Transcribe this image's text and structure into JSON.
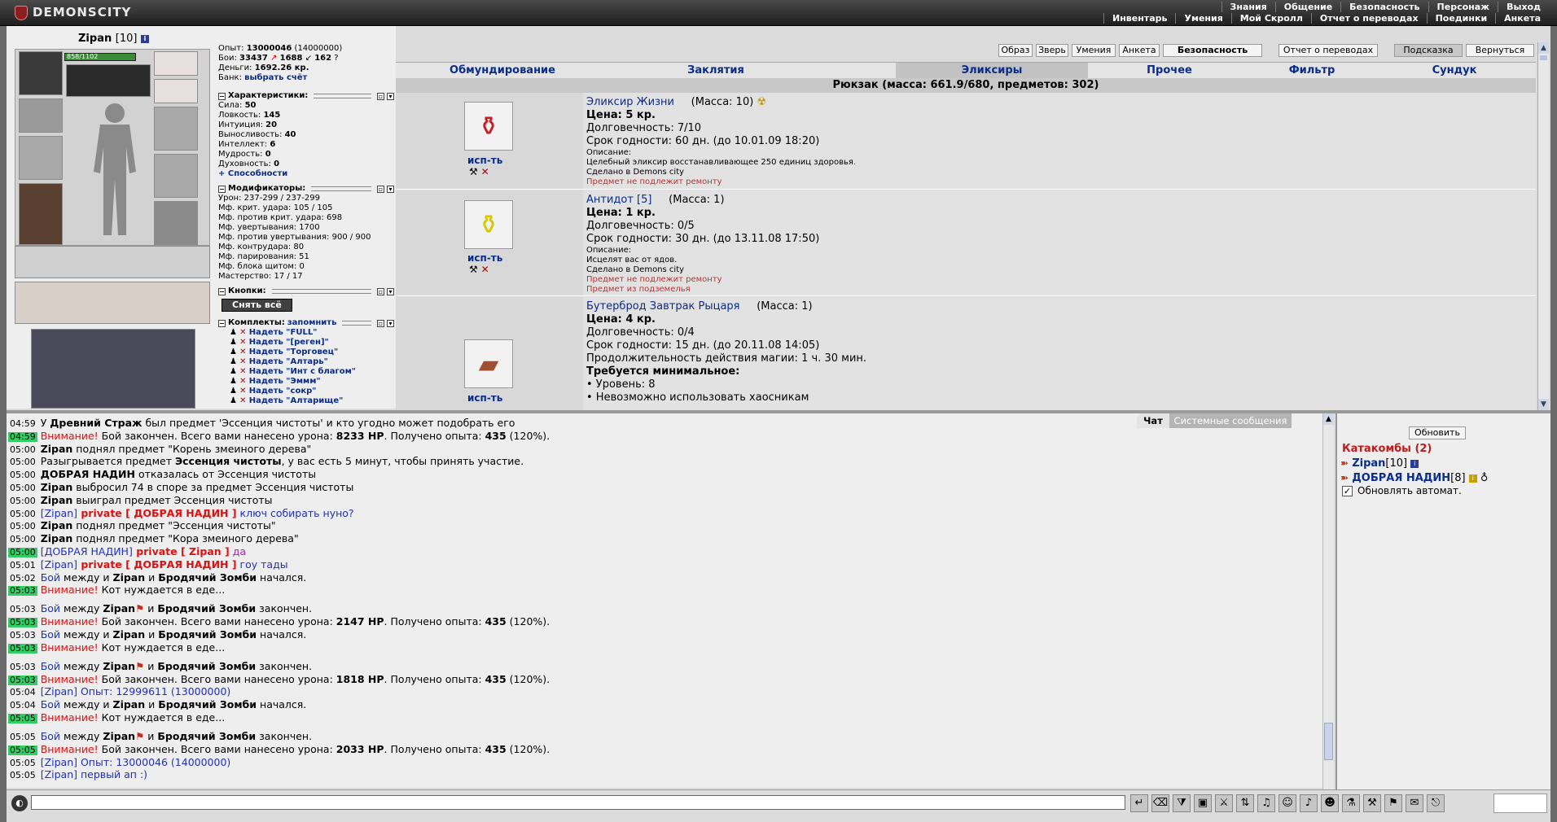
{
  "app": {
    "logo": "DEMONSCITY"
  },
  "menu": {
    "row1": [
      "Знания",
      "Общение",
      "Безопасность",
      "Персонаж",
      "Выход"
    ],
    "row2": [
      "Инвентарь",
      "Умения",
      "Мой Скролл",
      "Отчет о переводах",
      "Поединки",
      "Анкета"
    ]
  },
  "char": {
    "name": "Zipan",
    "level": "[10]",
    "hp": "858/1102",
    "exp": "13000046",
    "exp_next": "(14000000)",
    "battles_win": "33437",
    "battles_lose": "1688",
    "battles_draw": "162",
    "money": "1692.26 кр.",
    "bank": "выбрать счёт"
  },
  "labels": {
    "exp": "Опыт:",
    "battles": "Бои:",
    "money": "Деньги:",
    "bank": "Банк:",
    "abilities": "+ Способности",
    "undress": "Снять всё",
    "remember": "запомнить"
  },
  "sections": {
    "chars": "Характеристики:",
    "mods": "Модификаторы:",
    "buttons": "Кнопки:",
    "kits": "Комплекты:"
  },
  "attrs": [
    {
      "name": "Сила:",
      "value": "50"
    },
    {
      "name": "Ловкость:",
      "value": "145"
    },
    {
      "name": "Интуиция:",
      "value": "20"
    },
    {
      "name": "Выносливость:",
      "value": "40"
    },
    {
      "name": "Интеллект:",
      "value": "6"
    },
    {
      "name": "Мудрость:",
      "value": "0"
    },
    {
      "name": "Духовность:",
      "value": "0"
    }
  ],
  "mods": [
    "Урон: 237-299 / 237-299",
    "Мф. крит. удара: 105 / 105",
    "Мф. против крит. удара: 698",
    "Мф. увертывания: 1700",
    "Мф. против увертывания: 900 / 900",
    "Мф. контрудара: 80",
    "Мф. парирования: 51",
    "Мф. блока щитом: 0",
    "Мастерство: 17 / 17"
  ],
  "kits": [
    "Надеть \"FULL\"",
    "Надеть \"[реген]\"",
    "Надеть \"Торговец\"",
    "Надеть \"Алтарь\"",
    "Надеть \"Инт с благом\"",
    "Надеть \"Эммм\"",
    "Надеть \"сокр\"",
    "Надеть \"Алтарище\""
  ],
  "top_buttons": [
    "Образ",
    "Зверь",
    "Умения",
    "Анкета",
    "Безопасность",
    "Отчет о переводах",
    "Подсказка",
    "Вернуться"
  ],
  "nav_tabs": [
    "Обмундирование",
    "Заклятия",
    "Эликсиры",
    "Прочее",
    "Фильтр",
    "Сундук"
  ],
  "bag_header": "Рюкзак (масса: 661.9/680, предметов: 302)",
  "items": [
    {
      "icon": "potion-red-icon",
      "use": "исп-ть",
      "name": "Эликсир Жизни",
      "mass": "(Масса: 10)",
      "price": "Цена: 5 кр.",
      "lines": [
        "Долговечность: 7/10",
        "Срок годности: 60 дн. (до 10.01.09 18:20)"
      ],
      "small": [
        "Описание:",
        "Целебный эликсир восстанавливающее 250 единиц здоровья.",
        "Сделано в Demons city"
      ],
      "red": [
        "Предмет не подлежит ремонту"
      ]
    },
    {
      "icon": "potion-yellow-icon",
      "use": "исп-ть",
      "name": "Антидот [5]",
      "mass": "(Масса: 1)",
      "price": "Цена: 1 кр.",
      "lines": [
        "Долговечность: 0/5",
        "Срок годности: 30 дн. (до 13.11.08 17:50)"
      ],
      "small": [
        "Описание:",
        "Исцелят вас от ядов.",
        "Сделано в Demons city"
      ],
      "red": [
        "Предмет не подлежит ремонту",
        "Предмет из подземелья"
      ]
    },
    {
      "icon": "sandwich-icon",
      "use": "исп-ть",
      "name": "Бутерброд Завтрак Рыцаря",
      "mass": "(Масса: 1)",
      "price": "Цена: 4 кр.",
      "lines": [
        "Долговечность: 0/4",
        "Срок годности: 15 дн. (до 20.11.08 14:05)",
        "Продолжительность действия магии: 1 ч. 30 мин."
      ],
      "req_title": "Требуется минимальное:",
      "req": [
        "• Уровень: 8",
        "• Невозможно использовать хаосникам"
      ]
    }
  ],
  "chat_tabs": {
    "chat": "Чат",
    "system": "Системные сообщения"
  },
  "chat": [
    {
      "t": "04:59",
      "hl": false,
      "parts": [
        [
          "n",
          "У "
        ],
        [
          "b",
          "Древний Страж"
        ],
        [
          "n",
          " был предмет 'Эссенция чистоты' и кто угодно может подобрать его"
        ]
      ]
    },
    {
      "t": "04:59",
      "hl": true,
      "parts": [
        [
          "red",
          "Внимание!"
        ],
        [
          "n",
          " Бой закончен. Всего вами нанесено урона: "
        ],
        [
          "b",
          "8233 HP"
        ],
        [
          "n",
          ". Получено опыта: "
        ],
        [
          "b",
          "435"
        ],
        [
          "n",
          " (120%)."
        ]
      ]
    },
    {
      "t": "05:00",
      "hl": false,
      "parts": [
        [
          "b",
          "Zipan"
        ],
        [
          "n",
          " поднял предмет \"Корень змеиного дерева\""
        ]
      ]
    },
    {
      "t": "05:00",
      "hl": false,
      "parts": [
        [
          "n",
          "Разыгрывается предмет "
        ],
        [
          "b",
          "Эссенция чистоты"
        ],
        [
          "n",
          ", у вас есть 5 минут, чтобы принять участие."
        ]
      ]
    },
    {
      "t": "05:00",
      "hl": false,
      "parts": [
        [
          "b",
          "ДОБРАЯ НАДИН"
        ],
        [
          "n",
          " отказалась от Эссенция чистоты"
        ]
      ]
    },
    {
      "t": "05:00",
      "hl": false,
      "parts": [
        [
          "b",
          "Zipan"
        ],
        [
          "n",
          " выбросил 74 в споре за предмет Эссенция чистоты"
        ]
      ]
    },
    {
      "t": "05:00",
      "hl": false,
      "parts": [
        [
          "b",
          "Zipan"
        ],
        [
          "n",
          " выиграл предмет Эссенция чистоты"
        ]
      ]
    },
    {
      "t": "05:00",
      "hl": false,
      "parts": [
        [
          "pblue",
          "[Zipan]"
        ],
        [
          "priv",
          " private [ ДОБРАЯ НАДИН ]"
        ],
        [
          "pblue",
          " ключ собирать нуно?"
        ]
      ]
    },
    {
      "t": "05:00",
      "hl": false,
      "parts": [
        [
          "b",
          "Zipan"
        ],
        [
          "n",
          " поднял предмет \"Эссенция чистоты\""
        ]
      ]
    },
    {
      "t": "05:00",
      "hl": false,
      "parts": [
        [
          "b",
          "Zipan"
        ],
        [
          "n",
          " поднял предмет \"Кора змеиного дерева\""
        ]
      ]
    },
    {
      "t": "05:00",
      "hl": true,
      "parts": [
        [
          "pblue",
          "[ДОБРАЯ НАДИН]"
        ],
        [
          "priv",
          " private [ Zipan ]"
        ],
        [
          "pmag",
          " да"
        ]
      ]
    },
    {
      "t": "05:01",
      "hl": false,
      "parts": [
        [
          "pblue",
          "[Zipan]"
        ],
        [
          "priv",
          " private [ ДОБРАЯ НАДИН ]"
        ],
        [
          "pblue",
          " гоу тады"
        ]
      ]
    },
    {
      "t": "05:02",
      "hl": false,
      "parts": [
        [
          "blue",
          "Бой"
        ],
        [
          "n",
          " между и "
        ],
        [
          "b",
          "Zipan"
        ],
        [
          "n",
          " и "
        ],
        [
          "b",
          "Бродячий Зомби"
        ],
        [
          "n",
          " начался."
        ]
      ]
    },
    {
      "t": "05:03",
      "hl": true,
      "parts": [
        [
          "red",
          "Внимание!"
        ],
        [
          "n",
          " Кот нуждается в еде..."
        ]
      ]
    },
    {
      "t": "05:03",
      "hl": false,
      "tall": true,
      "parts": [
        [
          "blue",
          "Бой"
        ],
        [
          "n",
          " между "
        ],
        [
          "b",
          "Zipan"
        ],
        [
          "n",
          "  и "
        ],
        [
          "b",
          "Бродячий Зомби"
        ],
        [
          "n",
          " закончен."
        ]
      ]
    },
    {
      "t": "05:03",
      "hl": true,
      "parts": [
        [
          "red",
          "Внимание!"
        ],
        [
          "n",
          " Бой закончен. Всего вами нанесено урона: "
        ],
        [
          "b",
          "2147 HP"
        ],
        [
          "n",
          ". Получено опыта: "
        ],
        [
          "b",
          "435"
        ],
        [
          "n",
          " (120%)."
        ]
      ]
    },
    {
      "t": "05:03",
      "hl": false,
      "parts": [
        [
          "blue",
          "Бой"
        ],
        [
          "n",
          " между и "
        ],
        [
          "b",
          "Zipan"
        ],
        [
          "n",
          " и "
        ],
        [
          "b",
          "Бродячий Зомби"
        ],
        [
          "n",
          " начался."
        ]
      ]
    },
    {
      "t": "05:03",
      "hl": true,
      "parts": [
        [
          "red",
          "Внимание!"
        ],
        [
          "n",
          " Кот нуждается в еде..."
        ]
      ]
    },
    {
      "t": "05:03",
      "hl": false,
      "tall": true,
      "parts": [
        [
          "blue",
          "Бой"
        ],
        [
          "n",
          " между "
        ],
        [
          "b",
          "Zipan"
        ],
        [
          "n",
          "  и "
        ],
        [
          "b",
          "Бродячий Зомби"
        ],
        [
          "n",
          " закончен."
        ]
      ]
    },
    {
      "t": "05:03",
      "hl": true,
      "parts": [
        [
          "red",
          "Внимание!"
        ],
        [
          "n",
          " Бой закончен. Всего вами нанесено урона: "
        ],
        [
          "b",
          "1818 HP"
        ],
        [
          "n",
          ". Получено опыта: "
        ],
        [
          "b",
          "435"
        ],
        [
          "n",
          " (120%)."
        ]
      ]
    },
    {
      "t": "05:04",
      "hl": false,
      "parts": [
        [
          "pblue",
          "[Zipan]"
        ],
        [
          "pblue",
          " Опыт: 12999611 (13000000)"
        ]
      ]
    },
    {
      "t": "05:04",
      "hl": false,
      "parts": [
        [
          "blue",
          "Бой"
        ],
        [
          "n",
          " между и "
        ],
        [
          "b",
          "Zipan"
        ],
        [
          "n",
          " и "
        ],
        [
          "b",
          "Бродячий Зомби"
        ],
        [
          "n",
          " начался."
        ]
      ]
    },
    {
      "t": "05:05",
      "hl": true,
      "parts": [
        [
          "red",
          "Внимание!"
        ],
        [
          "n",
          " Кот нуждается в еде..."
        ]
      ]
    },
    {
      "t": "05:05",
      "hl": false,
      "tall": true,
      "parts": [
        [
          "blue",
          "Бой"
        ],
        [
          "n",
          " между "
        ],
        [
          "b",
          "Zipan"
        ],
        [
          "n",
          "  и "
        ],
        [
          "b",
          "Бродячий Зомби"
        ],
        [
          "n",
          " закончен."
        ]
      ]
    },
    {
      "t": "05:05",
      "hl": true,
      "parts": [
        [
          "red",
          "Внимание!"
        ],
        [
          "n",
          " Бой закончен. Всего вами нанесено урона: "
        ],
        [
          "b",
          "2033 HP"
        ],
        [
          "n",
          ". Получено опыта: "
        ],
        [
          "b",
          "435"
        ],
        [
          "n",
          " (120%)."
        ]
      ]
    },
    {
      "t": "05:05",
      "hl": false,
      "parts": [
        [
          "pblue",
          "[Zipan]"
        ],
        [
          "pblue",
          " Опыт: 13000046 (14000000)"
        ]
      ]
    },
    {
      "t": "05:05",
      "hl": false,
      "parts": [
        [
          "pblue",
          "[Zipan]"
        ],
        [
          "pblue",
          " первый ап :)"
        ]
      ]
    }
  ],
  "online": {
    "refresh": "Обновить",
    "room": "Катакомбы (2)",
    "users": [
      {
        "name": "Zipan",
        "level": "[10]"
      },
      {
        "name": "ДОБРАЯ НАДИН",
        "level": "[8]"
      }
    ],
    "auto_update": "Обновлять автомат."
  }
}
